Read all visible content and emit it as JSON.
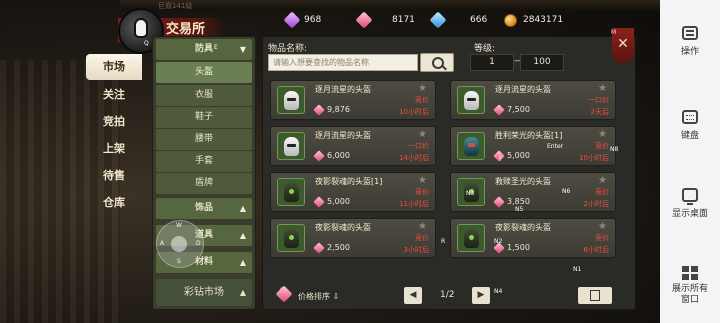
{
  "app": {
    "title": "交易所",
    "emblem_name": "巨裔141级"
  },
  "resources": [
    {
      "icon": "purple-gem-icon",
      "value": "968"
    },
    {
      "icon": "pink-gem-icon",
      "value": "8171"
    },
    {
      "icon": "blue-gem-icon",
      "value": "666"
    },
    {
      "icon": "gold-coin-icon",
      "value": "2843171"
    }
  ],
  "tabs": [
    {
      "label": "市场",
      "active": true
    },
    {
      "label": "关注",
      "active": false
    },
    {
      "label": "竞拍",
      "active": false
    },
    {
      "label": "上架",
      "active": false
    },
    {
      "label": "待售",
      "active": false
    },
    {
      "label": "仓库",
      "active": false
    }
  ],
  "categories": {
    "header": "防具",
    "items": [
      {
        "label": "头盔",
        "selected": true
      },
      {
        "label": "衣服",
        "selected": false
      },
      {
        "label": "鞋子",
        "selected": false
      },
      {
        "label": "腰带",
        "selected": false
      },
      {
        "label": "手套",
        "selected": false
      },
      {
        "label": "盾牌",
        "selected": false
      }
    ],
    "groups": [
      "饰品",
      "道具",
      "材料"
    ],
    "bottom": "彩钻市场"
  },
  "joystick": {
    "w": "W",
    "a": "A",
    "s": "S",
    "d": "D"
  },
  "search": {
    "label": "物品名称:",
    "placeholder": "请输入想要查找的物品名称",
    "level_label": "等级:",
    "level_min": "1",
    "level_max": "100",
    "level_sep": "—"
  },
  "close": {
    "label": "✕",
    "hotkey": "M"
  },
  "listings": [
    {
      "name": "逐月流星的头盔",
      "type": "竞价",
      "price": "9,876",
      "time": "10小时后",
      "helmet": "white",
      "overlay": ""
    },
    {
      "name": "逐月流星的头盔",
      "type": "一口价",
      "price": "7,500",
      "time": "2天后",
      "helmet": "white",
      "overlay": ""
    },
    {
      "name": "逐月流星的头盔",
      "type": "一口价",
      "price": "6,000",
      "time": "14小时后",
      "helmet": "white",
      "overlay": ""
    },
    {
      "name": "胜利荣光的头盔[1]",
      "type": "竞价",
      "price": "5,000",
      "time": "10小时后",
      "helmet": "teal",
      "overlay": "Enter"
    },
    {
      "name": "夜影裂魂的头盔[1]",
      "type": "竞价",
      "price": "5,000",
      "time": "11小时后",
      "helmet": "dark",
      "overlay": ""
    },
    {
      "name": "救赎圣光的头盔",
      "type": "竞价",
      "price": "3,850",
      "time": "2小时后",
      "helmet": "dark",
      "overlay": ""
    },
    {
      "name": "夜影裂魂的头盔",
      "type": "竞价",
      "price": "2,500",
      "time": "3小时后",
      "helmet": "dark",
      "overlay": ""
    },
    {
      "name": "夜影裂魂的头盔",
      "type": "竞价",
      "price": "1,500",
      "time": "6小时后",
      "helmet": "dark",
      "overlay": ""
    }
  ],
  "overlay_keys": [
    "N8",
    "N6",
    "N5",
    "N3",
    "N2",
    "N1",
    "N4",
    "R",
    "F",
    "H",
    "E",
    "Q"
  ],
  "footer": {
    "sort_label": "价格排序 ⇩",
    "page": "1/2",
    "prev": "◀",
    "next": "▶"
  },
  "sidebar_right": [
    {
      "label": "操作",
      "icon": "operations-icon"
    },
    {
      "label": "键盘",
      "icon": "keyboard-icon"
    },
    {
      "label": "显示桌面",
      "icon": "desktop-icon"
    },
    {
      "label": "展示所有窗口",
      "icon": "windows-icon"
    }
  ],
  "colors": {
    "accent_red": "#ee4b3d",
    "banner_red": "#7d1f1a",
    "category_green": "#4e5a3a",
    "item_slot_green": "#3c5a2d"
  }
}
